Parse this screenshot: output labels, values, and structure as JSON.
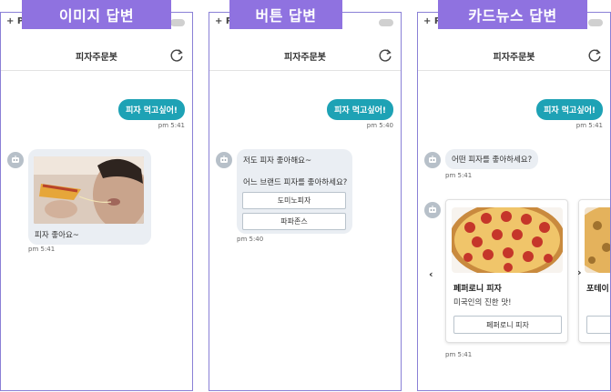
{
  "banners": {
    "image_reply": "이미지 답변",
    "button_reply": "버튼 답변",
    "cardnews_reply": "카드뉴스 답변"
  },
  "app": {
    "top_label": "+ P",
    "title": "피자주문봇"
  },
  "panel_image": {
    "user_message": "피자 먹고싶어!",
    "user_time": "pm 5:41",
    "bot_text": "피자 좋아요~",
    "bot_time": "pm 5:41"
  },
  "panel_button": {
    "user_message": "피자 먹고싶어!",
    "user_time": "pm 5:40",
    "bot_line1": "저도 피자 좋아해요~",
    "bot_line2": "어느 브랜드 피자를 좋아하세요?",
    "options": [
      "도미노피자",
      "파파존스"
    ],
    "bot_time": "pm 5:40"
  },
  "panel_card": {
    "user_message": "피자 먹고싶어!",
    "user_time": "pm 5:41",
    "bot_question": "어떤 피자를 좋아하세요?",
    "bot_time": "pm 5:41",
    "cards": [
      {
        "title": "페퍼로니 피자",
        "desc": "미국인의 진한 맛!",
        "button": "페퍼로니 피자"
      },
      {
        "title": "포테이"
      }
    ],
    "carousel_time": "pm 5:41"
  },
  "colors": {
    "banner": "#8f72e0",
    "user_bubble": "#1ea2b5",
    "bot_bubble": "#eaeef3",
    "panel_border": "#8a80d6"
  },
  "icons": [
    "refresh-icon",
    "bot-avatar-icon",
    "chevron-left-icon",
    "chevron-right-icon"
  ]
}
